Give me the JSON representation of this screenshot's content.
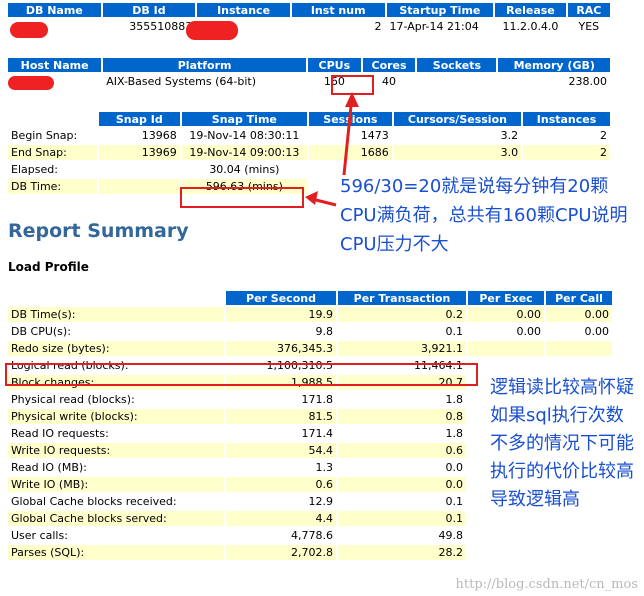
{
  "db_table": {
    "headers": [
      "DB Name",
      "DB Id",
      "Instance",
      "Inst num",
      "Startup Time",
      "Release",
      "RAC"
    ],
    "row": [
      "",
      "355510883",
      "",
      "2",
      "17-Apr-14 21:04",
      "11.2.0.4.0",
      "YES"
    ]
  },
  "host_table": {
    "headers": [
      "Host Name",
      "Platform",
      "CPUs",
      "Cores",
      "Sockets",
      "Memory (GB)"
    ],
    "row": [
      "",
      "AIX-Based Systems (64-bit)",
      "160",
      "40",
      "",
      "238.00"
    ]
  },
  "snap_table": {
    "headers": [
      "",
      "Snap Id",
      "Snap Time",
      "Sessions",
      "Cursors/Session",
      "Instances"
    ],
    "rows": [
      [
        "Begin Snap:",
        "13968",
        "19-Nov-14 08:30:11",
        "1473",
        "3.2",
        "2"
      ],
      [
        "End Snap:",
        "13969",
        "19-Nov-14 09:00:13",
        "1686",
        "3.0",
        "2"
      ],
      [
        "Elapsed:",
        "",
        "30.04 (mins)",
        "",
        "",
        ""
      ],
      [
        "DB Time:",
        "",
        "596.63 (mins)",
        "",
        "",
        ""
      ]
    ]
  },
  "report_summary": {
    "title": "Report Summary",
    "load_profile": "Load Profile"
  },
  "load_table": {
    "headers": [
      "",
      "Per Second",
      "Per Transaction",
      "Per Exec",
      "Per Call"
    ],
    "rows": [
      [
        "DB Time(s):",
        "19.9",
        "0.2",
        "0.00",
        "0.00"
      ],
      [
        "DB CPU(s):",
        "9.8",
        "0.1",
        "0.00",
        "0.00"
      ],
      [
        "Redo size (bytes):",
        "376,345.3",
        "3,921.1",
        "",
        ""
      ],
      [
        "Logical read (blocks):",
        "1,100,310.5",
        "11,464.1",
        "",
        ""
      ],
      [
        "Block changes:",
        "1,988.5",
        "20.7",
        "",
        ""
      ],
      [
        "Physical read (blocks):",
        "171.8",
        "1.8",
        "",
        ""
      ],
      [
        "Physical write (blocks):",
        "81.5",
        "0.8",
        "",
        ""
      ],
      [
        "Read IO requests:",
        "171.4",
        "1.8",
        "",
        ""
      ],
      [
        "Write IO requests:",
        "54.4",
        "0.6",
        "",
        ""
      ],
      [
        "Read IO (MB):",
        "1.3",
        "0.0",
        "",
        ""
      ],
      [
        "Write IO (MB):",
        "0.6",
        "0.0",
        "",
        ""
      ],
      [
        "Global Cache blocks received:",
        "12.9",
        "0.1",
        "",
        ""
      ],
      [
        "Global Cache blocks served:",
        "4.4",
        "0.1",
        "",
        ""
      ],
      [
        "User calls:",
        "4,778.6",
        "49.8",
        "",
        ""
      ],
      [
        "Parses (SQL):",
        "2,702.8",
        "28.2",
        "",
        ""
      ]
    ]
  },
  "annotations": {
    "cpu_note": "596/30=20就是说每分钟有20颗CPU满负荷，总共有160颗CPU说明CPU压力不大",
    "logical_read_note": "逻辑读比较高怀疑如果sql执行次数不多的情况下可能执行的代价比较高导致逻辑高"
  },
  "watermark": "http://blog.csdn.net/cn_mos",
  "colors": {
    "header_bg": "#0066cc",
    "odd_row": "#ffffcc",
    "annotation": "#1a4fd0",
    "highlight": "#e02020"
  }
}
